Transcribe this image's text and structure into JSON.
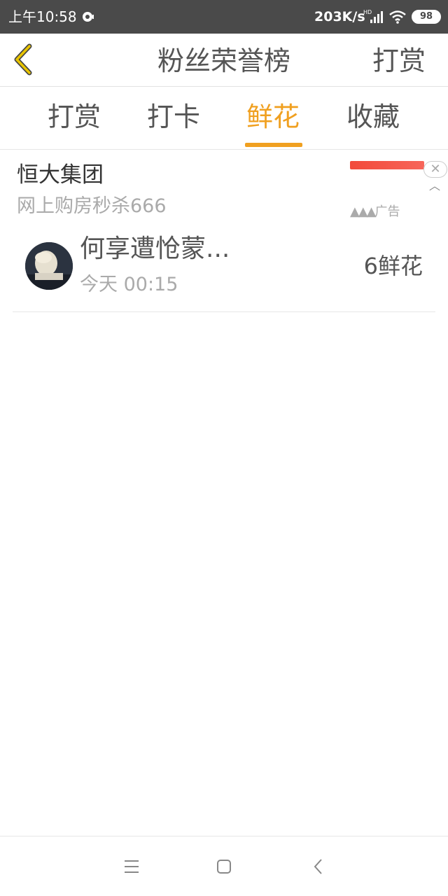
{
  "status_bar": {
    "time": "上午10:58",
    "network_speed": "203K/s",
    "battery": "98",
    "icons": [
      "app-notification-icon",
      "signal-icon",
      "wifi-icon",
      "battery-icon"
    ]
  },
  "header": {
    "title": "粉丝荣誉榜",
    "back_icon": "chevron-left-icon",
    "action_label": "打赏"
  },
  "tabs": [
    {
      "label": "打赏",
      "active": false
    },
    {
      "label": "打卡",
      "active": false
    },
    {
      "label": "鲜花",
      "active": true
    },
    {
      "label": "收藏",
      "active": false
    }
  ],
  "ad": {
    "title": "恒大集团",
    "description": "网上购房秒杀666",
    "label": "广告",
    "close_icon": "close-icon",
    "collapse_icon": "chevron-up-icon"
  },
  "list": [
    {
      "name": "何享遭怆蒙...",
      "time": "今天 00:15",
      "count": "6鲜花"
    }
  ],
  "navigation_bar": {
    "icons": [
      "menu-icon",
      "home-square-icon",
      "back-icon"
    ]
  },
  "colors": {
    "accent": "#f0a020",
    "status_bar_bg": "#4a4a4a",
    "back_icon": "#e8a400"
  }
}
